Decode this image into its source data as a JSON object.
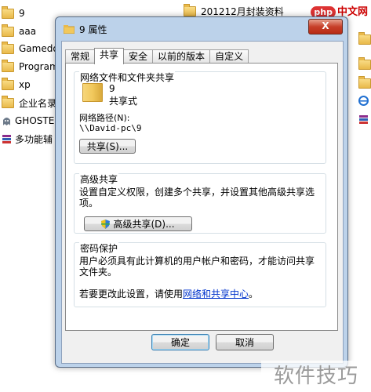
{
  "background": {
    "items": [
      {
        "label": "9",
        "icon": "folder-icon"
      },
      {
        "label": "aaa",
        "icon": "folder-icon"
      },
      {
        "label": "Gamedo",
        "icon": "folder-icon"
      },
      {
        "label": "Program",
        "icon": "folder-icon"
      },
      {
        "label": "xp",
        "icon": "folder-icon"
      },
      {
        "label": "企业名录",
        "icon": "folder-icon"
      },
      {
        "label": "GHOSTE",
        "icon": "ghost-app-icon"
      },
      {
        "label": "多功能辅",
        "icon": "archive-icon"
      }
    ],
    "top_right_item": "201212月封装资料",
    "watermark_top": {
      "badge": "php",
      "text": "中文网"
    }
  },
  "dialog": {
    "title": "9 属性",
    "close_label": "X",
    "tabs": [
      "常规",
      "共享",
      "安全",
      "以前的版本",
      "自定义"
    ],
    "active_tab": "共享",
    "network_share": {
      "group_title": "网络文件和文件夹共享",
      "name": "9",
      "status": "共享式",
      "path_label": "网络路径(N):",
      "path_value": "\\\\David-pc\\9",
      "share_button": "共享(S)..."
    },
    "advanced_share": {
      "group_title": "高级共享",
      "description": "设置自定义权限，创建多个共享，并设置其他高级共享选项。",
      "button": "高级共享(D)..."
    },
    "password": {
      "group_title": "密码保护",
      "description": "用户必须具有此计算机的用户帐户和密码，才能访问共享文件夹。",
      "change_prefix": "若要更改此设置，请使用",
      "change_link": "网络和共享中心",
      "change_suffix": "。"
    },
    "ok_button": "确定",
    "cancel_button": "取消"
  },
  "watermark_bottom": "软件技巧",
  "colors": {
    "dialog_frame": "#bcd2ea",
    "close_red": "#c7402a",
    "link": "#0033cc"
  }
}
